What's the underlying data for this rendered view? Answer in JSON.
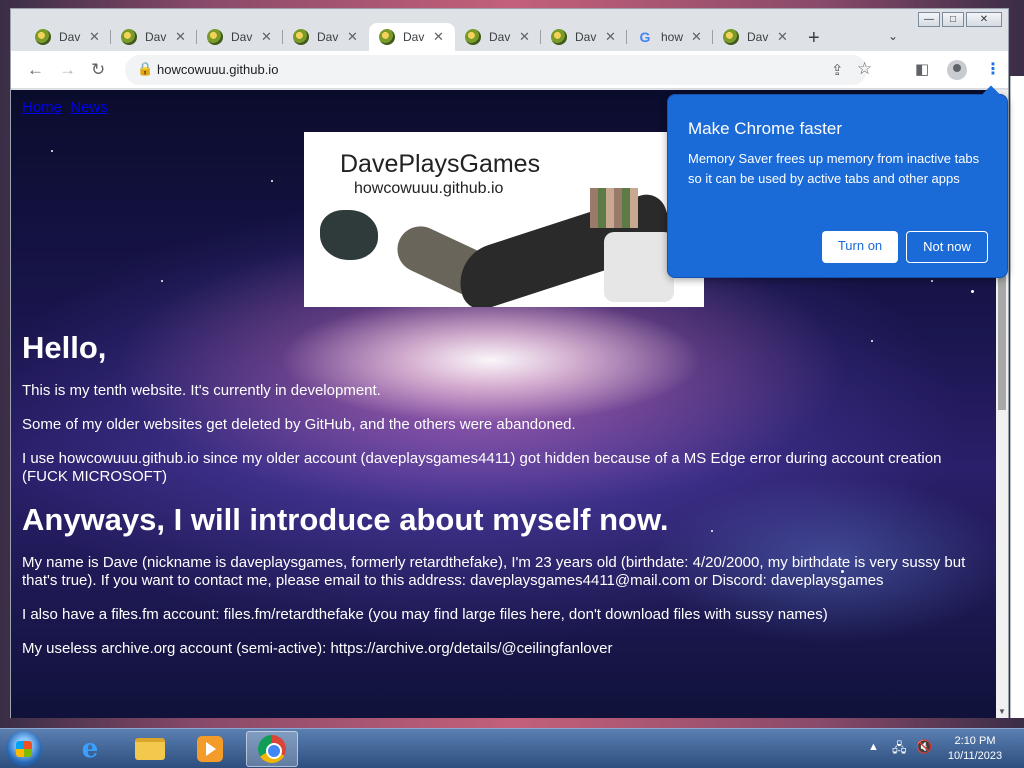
{
  "browser": {
    "tabs": [
      {
        "title": "Dav",
        "favicon": "dave-globe-icon",
        "active": false
      },
      {
        "title": "Dav",
        "favicon": "dave-globe-icon",
        "active": false
      },
      {
        "title": "Dav",
        "favicon": "dave-globe-icon",
        "active": false
      },
      {
        "title": "Dav",
        "favicon": "dave-globe-icon",
        "active": false
      },
      {
        "title": "Dav",
        "favicon": "dave-globe-icon",
        "active": true
      },
      {
        "title": "Dav",
        "favicon": "dave-globe-icon",
        "active": false
      },
      {
        "title": "Dav",
        "favicon": "dave-globe-icon",
        "active": false
      },
      {
        "title": "how",
        "favicon": "google-icon",
        "favicon_text": "G",
        "active": false
      },
      {
        "title": "Dav",
        "favicon": "dave-globe-icon",
        "active": false
      }
    ],
    "new_tab": "+",
    "tab_search": "⌄",
    "url": "howcowuuu.github.io",
    "window_controls": {
      "minimize": "—",
      "maximize": "□",
      "close": "✕"
    }
  },
  "page": {
    "nav": [
      "Home",
      "News"
    ],
    "banner": {
      "title": "DavePlaysGames",
      "subtitle": "howcowuuu.github.io"
    },
    "heading1": "Hello,",
    "p1": "This is my tenth website. It's currently in development.",
    "p2": "Some of my older websites get deleted by GitHub, and the others were abandoned.",
    "p3": "I use howcowuuu.github.io since my older account (daveplaysgames4411) got hidden because of a MS Edge error during account creation (FUCK MICROSOFT)",
    "heading2": "Anyways, I will introduce about myself now.",
    "p4": "My name is Dave (nickname is daveplaysgames, formerly retardthefake), I'm 23 years old (birthdate: 4/20/2000, my birthdate is very sussy but that's true). If you want to contact me, please email to this address: daveplaysgames4411@mail.com or Discord: daveplaysgames",
    "p5": "I also have a files.fm account: files.fm/retardthefake (you may find large files here, don't download files with sussy names)",
    "p6": "My useless archive.org account (semi-active): https://archive.org/details/@ceilingfanlover"
  },
  "popup": {
    "title": "Make Chrome faster",
    "body": "Memory Saver frees up memory from inactive tabs so it can be used by active tabs and other apps",
    "turn_on": "Turn on",
    "not_now": "Not now"
  },
  "taskbar": {
    "time": "2:10 PM",
    "date": "10/11/2023",
    "apps": [
      "internet-explorer",
      "file-explorer",
      "media-player",
      "chrome"
    ]
  },
  "colors": {
    "popup_bg": "#1a6ad8",
    "link": "#0000ee",
    "accent": "#1a73e8"
  }
}
